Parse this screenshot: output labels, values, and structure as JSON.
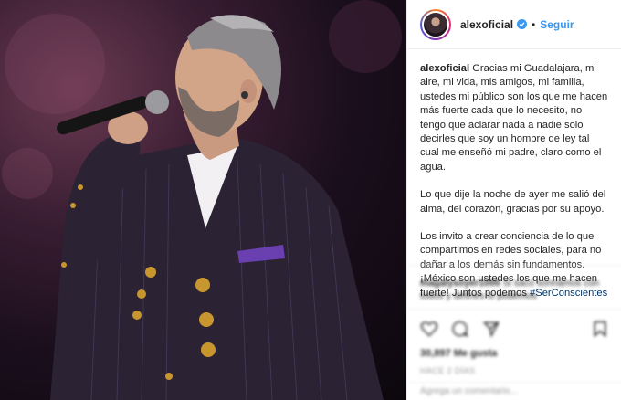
{
  "post": {
    "username": "alexoficial",
    "follow_label": "Seguir",
    "separator": "•",
    "caption_paragraphs": [
      "Gracias mi Guadalajara, mi aire, mi vida, mis amigos, mi familia, ustedes mi público son los que me hacen más fuerte cada que lo necesito, no tengo que aclarar nada a nadie solo decirles que soy un hombre de ley tal cual me enseñó mi padre, claro como el agua.",
      "Lo que dije la noche de ayer me salió del alma, del corazón, gracias por su apoyo.",
      "Los invito a crear conciencia de lo que compartimos en redes sociales, para no dañar a los demás sin fundamentos. ¡México son ustedes los que me hacen fuerte! Juntos podemos"
    ],
    "hashtag": "#SerConscientes",
    "comment_user": "magalysoyer1000",
    "comment_text": "Si saco sonriamos con todos y defines lo podemos",
    "likes": "30,897 Me gusta",
    "timestamp": "HACE 2 DÍAS",
    "comment_placeholder": "Agrega un comentario..."
  },
  "icons": {
    "verified": "verified-badge-icon",
    "like": "heart-icon",
    "comment": "comment-icon",
    "share": "share-icon",
    "save": "bookmark-icon"
  },
  "colors": {
    "link": "#3897f0",
    "hashtag": "#003569",
    "border": "#efefef"
  }
}
